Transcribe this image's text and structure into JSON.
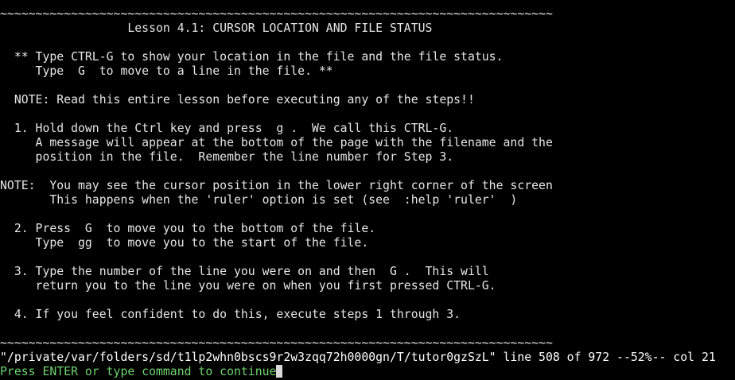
{
  "buffer": {
    "lines": [
      "~~~~~~~~~~~~~~~~~~~~~~~~~~~~~~~~~~~~~~~~~~~~~~~~~~~~~~~~~~~~~~~~~~~~~~~~~~~~~~",
      "                  Lesson 4.1: CURSOR LOCATION AND FILE STATUS",
      "",
      "  ** Type CTRL-G to show your location in the file and the file status.",
      "     Type  G  to move to a line in the file. **",
      "",
      "  NOTE: Read this entire lesson before executing any of the steps!!",
      "",
      "  1. Hold down the Ctrl key and press  g .  We call this CTRL-G.",
      "     A message will appear at the bottom of the page with the filename and the",
      "     position in the file.  Remember the line number for Step 3.",
      "",
      "NOTE:  You may see the cursor position in the lower right corner of the screen",
      "       This happens when the 'ruler' option is set (see  :help 'ruler'  )",
      "",
      "  2. Press  G  to move you to the bottom of the file.",
      "     Type  gg  to move you to the start of the file.",
      "",
      "  3. Type the number of the line you were on and then  G .  This will",
      "     return you to the line you were on when you first pressed CTRL-G.",
      "",
      "  4. If you feel confident to do this, execute steps 1 through 3.",
      "",
      "~~~~~~~~~~~~~~~~~~~~~~~~~~~~~~~~~~~~~~~~~~~~~~~~~~~~~~~~~~~~~~~~~~~~~~~~~~~~~~"
    ]
  },
  "status_line": "\"/private/var/folders/sd/t1lp2whn0bscs9r2w3zqq72h0000gn/T/tutor0gzSzL\" line 508 of 972 --52%-- col 21",
  "prompt_line": "Press ENTER or type command to continue",
  "colors": {
    "background": "#000000",
    "text": "#e6e6e6",
    "prompt": "#6fd36f",
    "cursor": "#d9d9d9"
  }
}
